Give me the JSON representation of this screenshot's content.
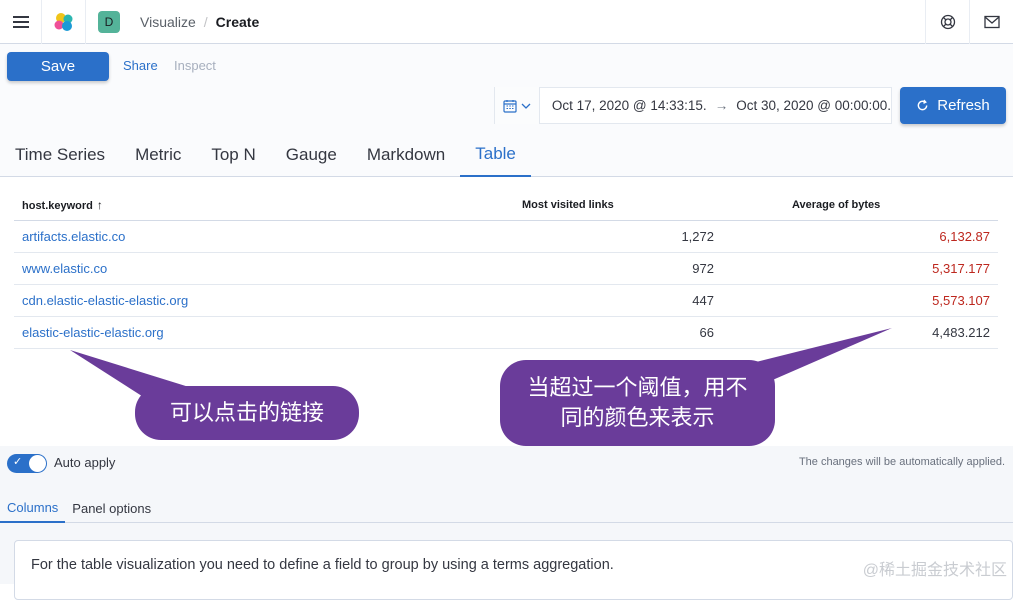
{
  "header": {
    "space_initial": "D",
    "breadcrumbs": [
      "Visualize",
      "Create"
    ],
    "breadcrumb_separator": "/"
  },
  "toolbar": {
    "save_label": "Save",
    "share_label": "Share",
    "inspect_label": "Inspect"
  },
  "query": {
    "start_date": "Oct 17, 2020 @ 14:33:15.",
    "end_date": "Oct 30, 2020 @ 00:00:00.",
    "refresh_label": "Refresh"
  },
  "tabs": [
    "Time Series",
    "Metric",
    "Top N",
    "Gauge",
    "Markdown",
    "Table"
  ],
  "active_tab": "Table",
  "table": {
    "headers": [
      "host.keyword",
      "Most visited links",
      "Average of bytes"
    ],
    "rows": [
      {
        "host": "artifacts.elastic.co",
        "visits": "1,272",
        "bytes": "6,132.87",
        "over_threshold": true
      },
      {
        "host": "www.elastic.co",
        "visits": "972",
        "bytes": "5,317.177",
        "over_threshold": true
      },
      {
        "host": "cdn.elastic-elastic-elastic.org",
        "visits": "447",
        "bytes": "5,573.107",
        "over_threshold": true
      },
      {
        "host": "elastic-elastic-elastic.org",
        "visits": "66",
        "bytes": "4,483.212",
        "over_threshold": false
      }
    ]
  },
  "annotations": {
    "links_note": "可以点击的链接",
    "threshold_note_line1": "当超过一个阈值，用不",
    "threshold_note_line2": "同的颜色来表示"
  },
  "editor": {
    "auto_apply_label": "Auto apply",
    "auto_apply_on": true,
    "changes_note": "The changes will be automatically applied.",
    "subtabs": [
      "Columns",
      "Panel options"
    ],
    "panel_text": "For the table visualization you need to define a field to group by using a terms aggregation."
  },
  "watermark": "@稀土掘金技术社区",
  "colors": {
    "accent": "#2b70c9",
    "threshold_red": "#bd271e",
    "bubble": "#6a3c9a"
  }
}
